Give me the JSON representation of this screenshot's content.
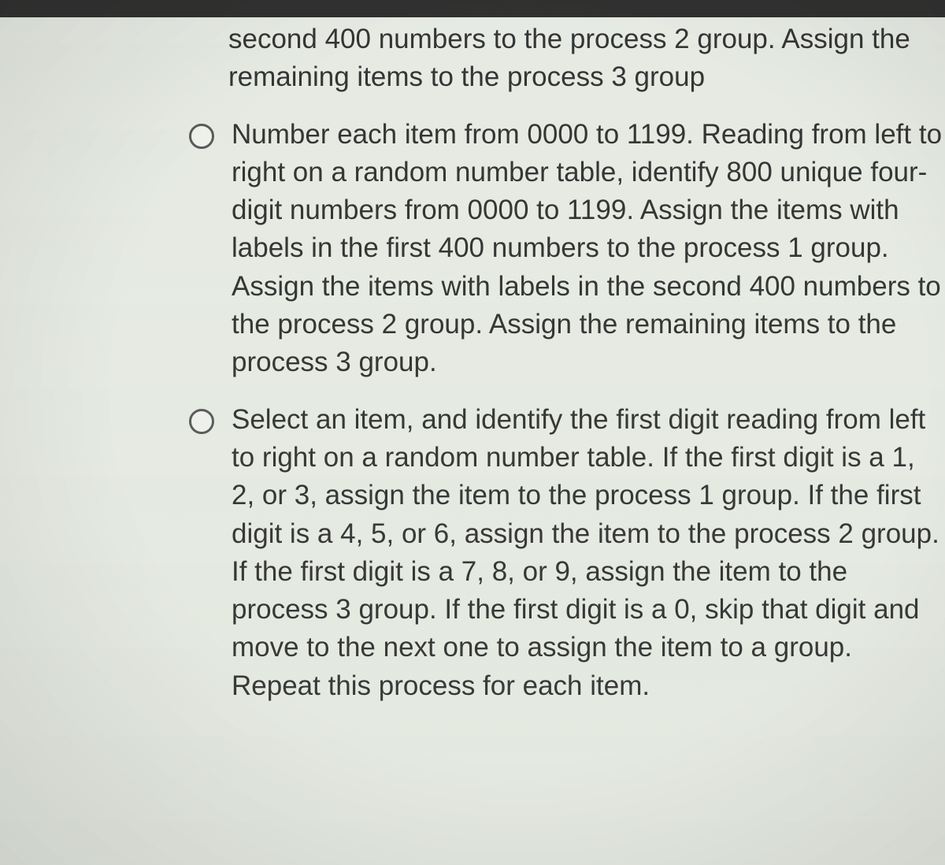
{
  "options": {
    "partial_top": "second 400 numbers to the process 2 group. Assign the remaining items to the process 3 group",
    "opt_b": "Number each item from 0000 to 1199. Reading from left to right on a random number table, identify 800 unique four-digit numbers from 0000 to 1199. Assign the items with labels in the first 400 numbers to the process 1 group. Assign the items with labels in the second 400 numbers to the process 2 group. Assign the remaining items to the process 3 group.",
    "opt_c": "Select an item, and identify the first digit reading from left to right on a random number table. If the first digit is a 1, 2, or 3, assign the item to the process 1 group. If the first digit is a 4, 5, or 6, assign the item to the process 2 group. If the first digit is a 7, 8, or 9, assign the item to the process 3 group. If the first digit is a 0, skip that digit and move to the next one to assign the item to a group. Repeat this process for each item."
  }
}
